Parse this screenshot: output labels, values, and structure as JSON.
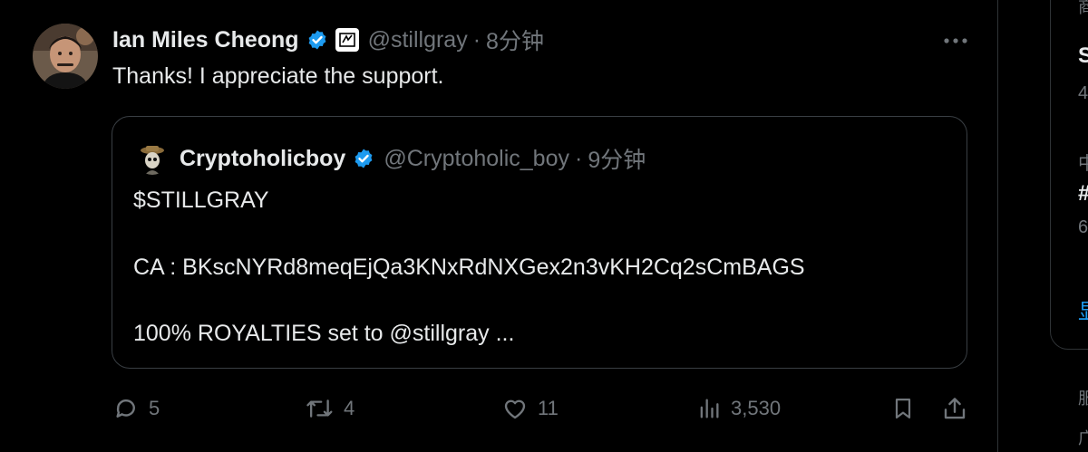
{
  "tweet": {
    "author_name": "Ian Miles Cheong",
    "handle": "@stillgray",
    "separator": "·",
    "time": "8分钟",
    "text": "Thanks! I appreciate the support.",
    "verified_icon": "verified-badge-icon",
    "affiliation_icon": "affiliation-badge-icon",
    "more_icon": "more-icon"
  },
  "quote": {
    "author_name": "Cryptoholicboy",
    "handle": "@Cryptoholic_boy",
    "separator": "·",
    "time": "9分钟",
    "lines": [
      "$STILLGRAY",
      "CA : BKscNYRd8meqEjQa3KNxRdNXGex2n3vKH2Cq2sCmBAGS",
      "100% ROYALTIES set to @stillgray ..."
    ]
  },
  "actions": {
    "replies": "5",
    "reposts": "4",
    "likes": "11",
    "views": "3,530"
  },
  "sidebar": {
    "fragments": [
      "商",
      "S",
      "4",
      "中",
      "#",
      "6",
      "显",
      "服",
      "广"
    ]
  },
  "colors": {
    "background": "#000000",
    "text": "#e7e9ea",
    "muted": "#71767b",
    "verified": "#1d9bf0",
    "link": "#1d9bf0",
    "border": "#2f3336"
  }
}
